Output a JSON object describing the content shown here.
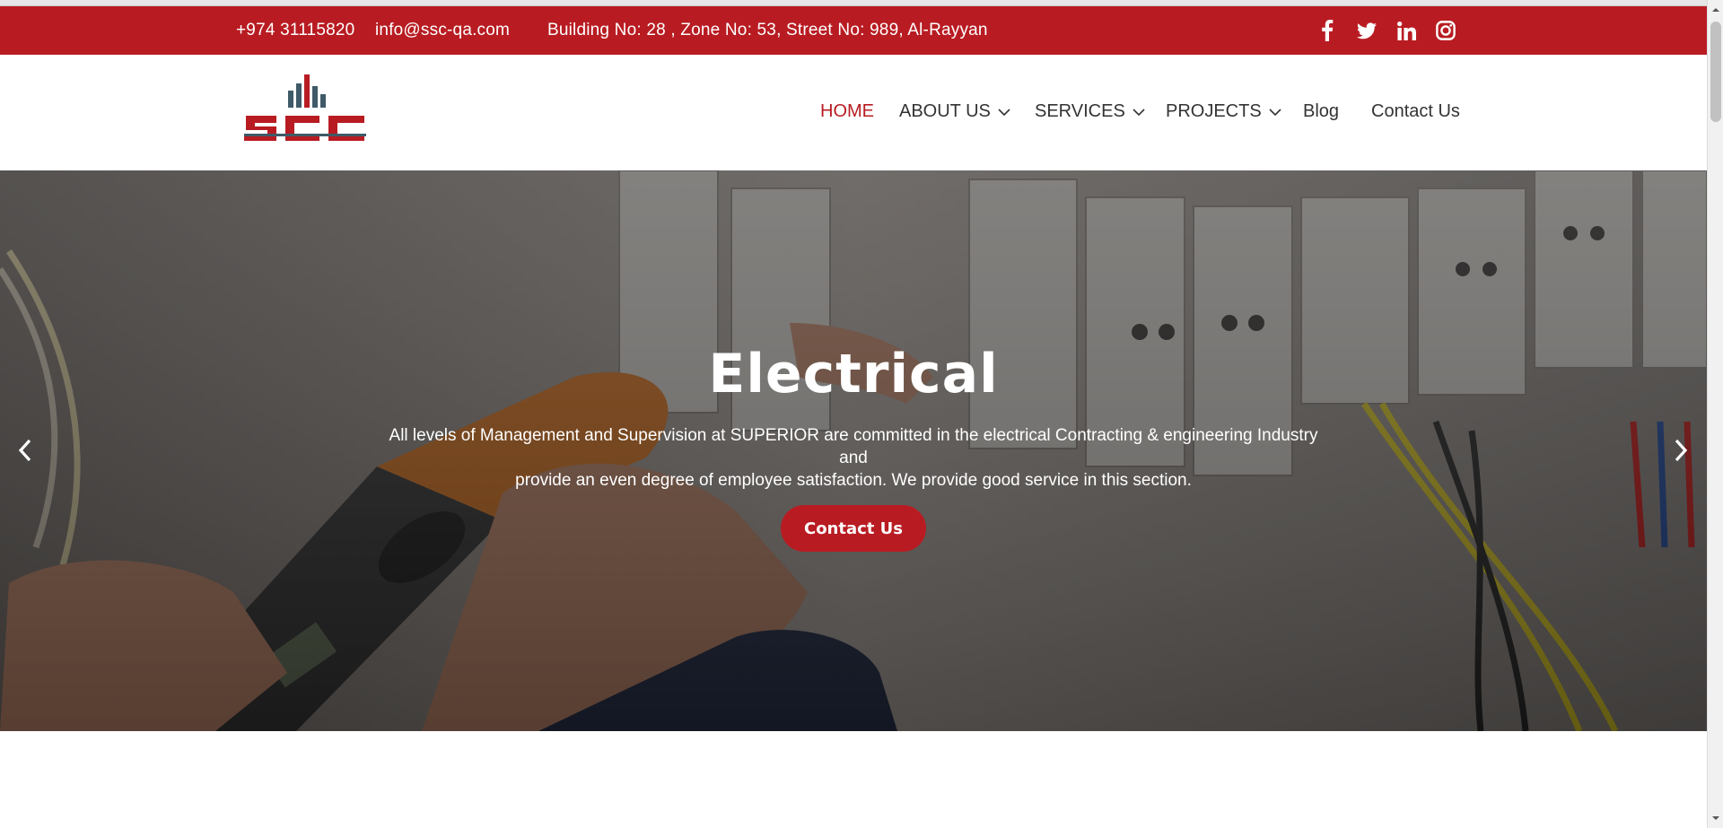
{
  "topbar": {
    "phone": "+974 31115820",
    "email": "info@ssc-qa.com",
    "address": "Building No: 28 , Zone No: 53, Street No: 989, Al-Rayyan",
    "social": [
      "facebook-icon",
      "twitter-icon",
      "linkedin-icon",
      "instagram-icon"
    ],
    "bg_color": "#b81c22"
  },
  "header": {
    "logo_text": "SCC",
    "nav": {
      "home": "HOME",
      "about": "ABOUT US",
      "services": "SERVICES",
      "projects": "PROJECTS",
      "blog": "Blog",
      "contact": "Contact Us"
    },
    "active_item": "HOME"
  },
  "hero": {
    "title": "Electrical",
    "description_line1": "All levels of Management and Supervision at SUPERIOR are committed in the electrical Contracting & engineering Industry and",
    "description_line2": "provide an even degree of employee satisfaction. We provide good service in this section.",
    "cta_label": "Contact Us",
    "prev_icon": "chevron-left-icon",
    "next_icon": "chevron-right-icon"
  },
  "colors": {
    "accent": "#b81c22",
    "nav_text": "#333333",
    "white": "#ffffff"
  }
}
